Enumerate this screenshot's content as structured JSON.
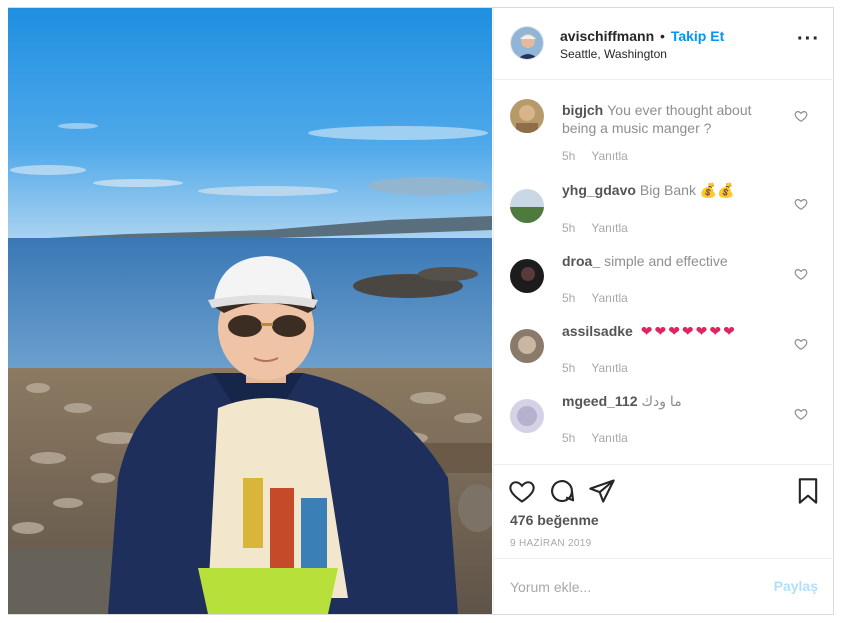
{
  "header": {
    "username": "avischiffmann",
    "separator": "•",
    "follow_label": "Takip Et",
    "location": "Seattle, Washington",
    "more_icon": "more-horizontal-icon"
  },
  "comments": [
    {
      "user": "bigjch",
      "text": "You ever thought about being a music manger ?",
      "time": "5h",
      "reply": "Yanıtla"
    },
    {
      "user": "yhg_gdavo",
      "text": "Big Bank",
      "emoji": "💰💰",
      "time": "5h",
      "reply": "Yanıtla"
    },
    {
      "user": "droa_",
      "text": "simple and effective",
      "time": "5h",
      "reply": "Yanıtla"
    },
    {
      "user": "assilsadke",
      "text": "",
      "emoji": "❤❤❤❤❤❤❤",
      "time": "5h",
      "reply": "Yanıtla"
    },
    {
      "user": "mgeed_112",
      "text": "ما ودك",
      "time": "5h",
      "reply": "Yanıtla"
    }
  ],
  "actions": {
    "like_icon": "heart-icon",
    "comment_icon": "comment-icon",
    "share_icon": "send-icon",
    "save_icon": "bookmark-icon"
  },
  "likes_label": "476 beğenme",
  "date_label": "9 HAZİRAN 2019",
  "add_comment": {
    "placeholder": "Yorum ekle...",
    "post_label": "Paylaş"
  },
  "colors": {
    "follow": "#0095f6",
    "heart_emoji": "#e0245e",
    "post_disabled": "#b2dffc"
  }
}
